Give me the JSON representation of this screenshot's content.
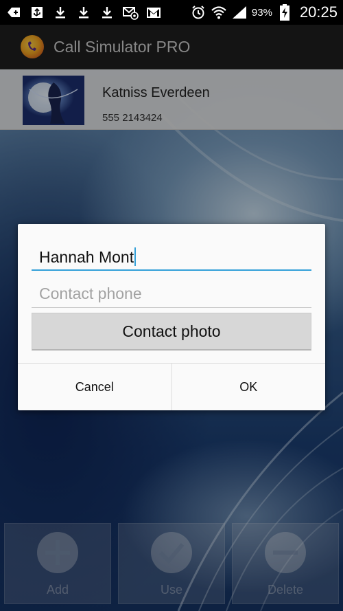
{
  "status_bar": {
    "battery_percent": "93%",
    "time": "20:25",
    "icons": [
      "add-box-icon",
      "usb-icon",
      "download-icon",
      "download-icon",
      "download-icon",
      "email-at-icon",
      "gmail-icon",
      "alarm-icon",
      "wifi-icon",
      "signal-icon",
      "battery-charging-icon"
    ]
  },
  "app_bar": {
    "title": "Call Simulator PRO"
  },
  "contact": {
    "name": "Katniss Everdeen",
    "phone": "555 2143424"
  },
  "dialog": {
    "name_value": "Hannah Mont",
    "phone_placeholder": "Contact phone",
    "photo_button_label": "Contact photo",
    "cancel_label": "Cancel",
    "ok_label": "OK"
  },
  "bottom_actions": [
    {
      "label": "Add",
      "icon": "plus-circle-icon"
    },
    {
      "label": "Use",
      "icon": "check-circle-icon"
    },
    {
      "label": "Delete",
      "icon": "minus-circle-icon"
    }
  ],
  "colors": {
    "accent": "#33a0d8",
    "action_bar": "#1f1f1f",
    "dialog_bg": "#fafafa"
  }
}
